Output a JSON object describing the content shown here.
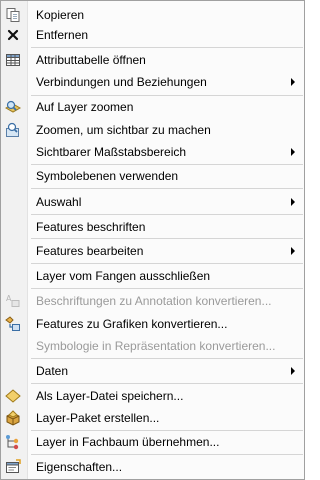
{
  "menu": {
    "items": [
      {
        "label": "Kopieren",
        "icon": "copy-icon",
        "enabled": true,
        "submenu": false
      },
      {
        "label": "Entfernen",
        "icon": "remove-x-icon",
        "enabled": true,
        "submenu": false
      },
      {
        "label": "Attributtabelle öffnen",
        "icon": "attribute-table-icon",
        "enabled": true,
        "submenu": false
      },
      {
        "label": "Verbindungen und Beziehungen",
        "icon": null,
        "enabled": true,
        "submenu": true
      },
      {
        "label": "Auf Layer zoomen",
        "icon": "zoom-to-layer-icon",
        "enabled": true,
        "submenu": false
      },
      {
        "label": "Zoomen, um sichtbar zu machen",
        "icon": "zoom-to-visible-icon",
        "enabled": true,
        "submenu": false
      },
      {
        "label": "Sichtbarer Maßstabsbereich",
        "icon": null,
        "enabled": true,
        "submenu": true
      },
      {
        "label": "Symbolebenen verwenden",
        "icon": null,
        "enabled": true,
        "submenu": false
      },
      {
        "label": "Auswahl",
        "icon": null,
        "enabled": true,
        "submenu": true
      },
      {
        "label": "Features beschriften",
        "icon": null,
        "enabled": true,
        "submenu": false
      },
      {
        "label": "Features bearbeiten",
        "icon": null,
        "enabled": true,
        "submenu": true
      },
      {
        "label": "Layer vom Fangen ausschließen",
        "icon": null,
        "enabled": true,
        "submenu": false
      },
      {
        "label": "Beschriftungen zu Annotation konvertieren...",
        "icon": "convert-labels-icon",
        "enabled": false,
        "submenu": false
      },
      {
        "label": "Features zu Grafiken konvertieren...",
        "icon": "convert-to-graphics-icon",
        "enabled": true,
        "submenu": false
      },
      {
        "label": "Symbologie in Repräsentation konvertieren...",
        "icon": null,
        "enabled": false,
        "submenu": false
      },
      {
        "label": "Daten",
        "icon": null,
        "enabled": true,
        "submenu": true
      },
      {
        "label": "Als Layer-Datei speichern...",
        "icon": "layer-file-icon",
        "enabled": true,
        "submenu": false
      },
      {
        "label": "Layer-Paket erstellen...",
        "icon": "layer-package-icon",
        "enabled": true,
        "submenu": false
      },
      {
        "label": "Layer in Fachbaum übernehmen...",
        "icon": "tree-icon",
        "enabled": true,
        "submenu": false
      },
      {
        "label": "Eigenschaften...",
        "icon": "properties-icon",
        "enabled": true,
        "submenu": false
      }
    ]
  }
}
